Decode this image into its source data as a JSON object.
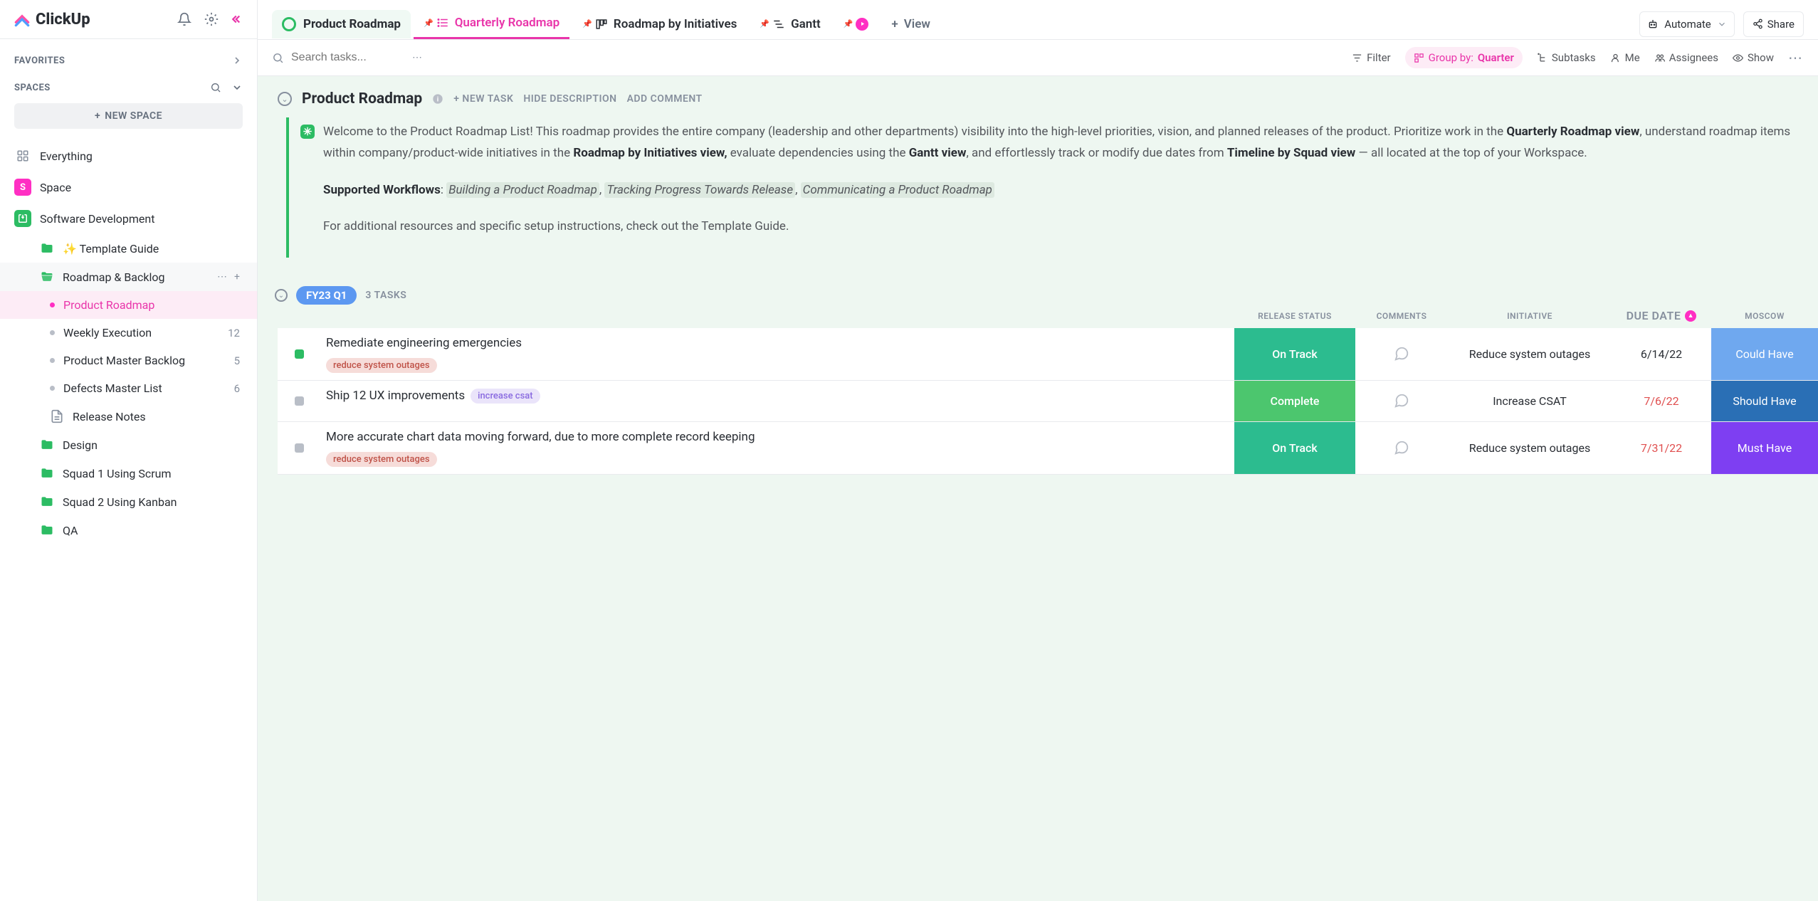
{
  "app": {
    "name": "ClickUp"
  },
  "sidebar": {
    "favorites": "FAVORITES",
    "spaces": "SPACES",
    "new_space": "NEW SPACE",
    "everything": "Everything",
    "space": "Space",
    "software_dev": "Software Development",
    "items": {
      "template_guide": "✨ Template Guide",
      "roadmap_backlog": "Roadmap & Backlog",
      "product_roadmap": "Product Roadmap",
      "weekly_execution": "Weekly Execution",
      "weekly_execution_count": "12",
      "master_backlog": "Product Master Backlog",
      "master_backlog_count": "5",
      "defects": "Defects Master List",
      "defects_count": "6",
      "release_notes": "Release Notes",
      "design": "Design",
      "squad1": "Squad 1 Using Scrum",
      "squad2": "Squad 2 Using Kanban",
      "qa": "QA"
    }
  },
  "tabs": {
    "crumb": "Product Roadmap",
    "quarterly": "Quarterly Roadmap",
    "initiatives": "Roadmap by Initiatives",
    "gantt": "Gantt",
    "add_view": "View",
    "automate": "Automate",
    "share": "Share"
  },
  "toolbar": {
    "search_placeholder": "Search tasks...",
    "filter": "Filter",
    "group_label": "Group by:",
    "group_value": "Quarter",
    "subtasks": "Subtasks",
    "me": "Me",
    "assignees": "Assignees",
    "show": "Show"
  },
  "list": {
    "title": "Product Roadmap",
    "new_task": "+ NEW TASK",
    "hide_desc": "HIDE DESCRIPTION",
    "add_comment": "ADD COMMENT",
    "desc_p1a": "Welcome to the Product Roadmap List! This roadmap provides the entire company (leadership and other departments) visibility into the high-level priorities, vision, and planned releases of the product. Prioritize work in the ",
    "desc_p1b": "Quarterly Roadmap view",
    "desc_p1c": ", understand roadmap items within company/product-wide initiatives in the ",
    "desc_p1d": "Roadmap by Initiatives view,",
    "desc_p1e": " evaluate dependencies using the ",
    "desc_p1f": "Gantt view",
    "desc_p1g": ", and effortlessly track or modify due dates from ",
    "desc_p1h": "Timeline by Squad view",
    "desc_p1i": " — all located at the top of your Workspace.",
    "desc_p2a": "Supported Workflows",
    "desc_p2b": "Building a Product Roadmap",
    "desc_p2c": "Tracking Progress Towards Release",
    "desc_p2d": "Communicating a Product Roadmap",
    "desc_p3": "For additional resources and specific setup instructions, check out the Template Guide."
  },
  "group": {
    "label": "FY23 Q1",
    "count": "3 TASKS"
  },
  "columns": {
    "status": "RELEASE STATUS",
    "comments": "COMMENTS",
    "initiative": "INITIATIVE",
    "due": "DUE DATE",
    "moscow": "MOSCOW"
  },
  "tasks": [
    {
      "title": "Remediate engineering emergencies",
      "tag": "reduce system outages",
      "tag_class": "red",
      "status": "On Track",
      "status_class": "ontrack",
      "box": "green",
      "initiative": "Reduce system outages",
      "due": "6/14/22",
      "due_class": "black",
      "moscow": "Could Have",
      "moscow_class": "could"
    },
    {
      "title": "Ship 12 UX improvements",
      "tag": "increase csat",
      "tag_class": "purple",
      "tag_inline": true,
      "status": "Complete",
      "status_class": "complete",
      "box": "grey",
      "initiative": "Increase CSAT",
      "due": "7/6/22",
      "due_class": "red",
      "moscow": "Should Have",
      "moscow_class": "should"
    },
    {
      "title": "More accurate chart data moving forward, due to more complete record keeping",
      "tag": "reduce system outages",
      "tag_class": "red",
      "status": "On Track",
      "status_class": "ontrack",
      "box": "grey",
      "initiative": "Reduce system outages",
      "due": "7/31/22",
      "due_class": "red",
      "moscow": "Must Have",
      "moscow_class": "must"
    }
  ]
}
